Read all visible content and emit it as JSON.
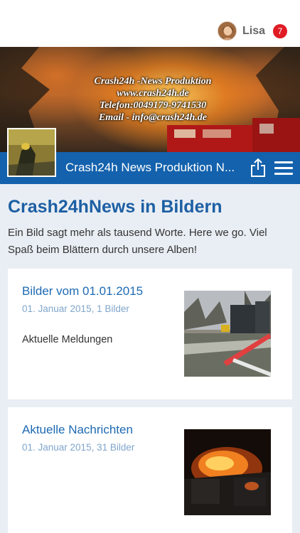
{
  "user": {
    "name": "Lisa",
    "notification_count": "7",
    "avatar_icon": "user-avatar-icon"
  },
  "banner": {
    "lines": [
      "Crash24h -News Produktion",
      "www.crash24h.de",
      "Telefon:0049179-9741530",
      "Email - info@crash24h.de"
    ]
  },
  "header": {
    "title": "Crash24h News Produktion N...",
    "share_icon": "share-icon",
    "menu_icon": "hamburger-menu-icon",
    "color": "#1462ad"
  },
  "page": {
    "title": "Crash24hNews in Bildern",
    "description": "Ein Bild sagt mehr als tausend Worte. Here we go. Viel Spaß beim Blättern durch unsere Alben!"
  },
  "albums": [
    {
      "title": "Bilder vom 01.01.2015",
      "meta": "01. Januar 2015, 1 Bilder",
      "text": "Aktuelle Meldungen"
    },
    {
      "title": "Aktuelle Nachrichten",
      "meta": "01. Januar 2015, 31 Bilder",
      "text": ""
    }
  ],
  "colors": {
    "accent": "#1d5fa3",
    "badge": "#e01b24",
    "background": "#e9eef4"
  }
}
